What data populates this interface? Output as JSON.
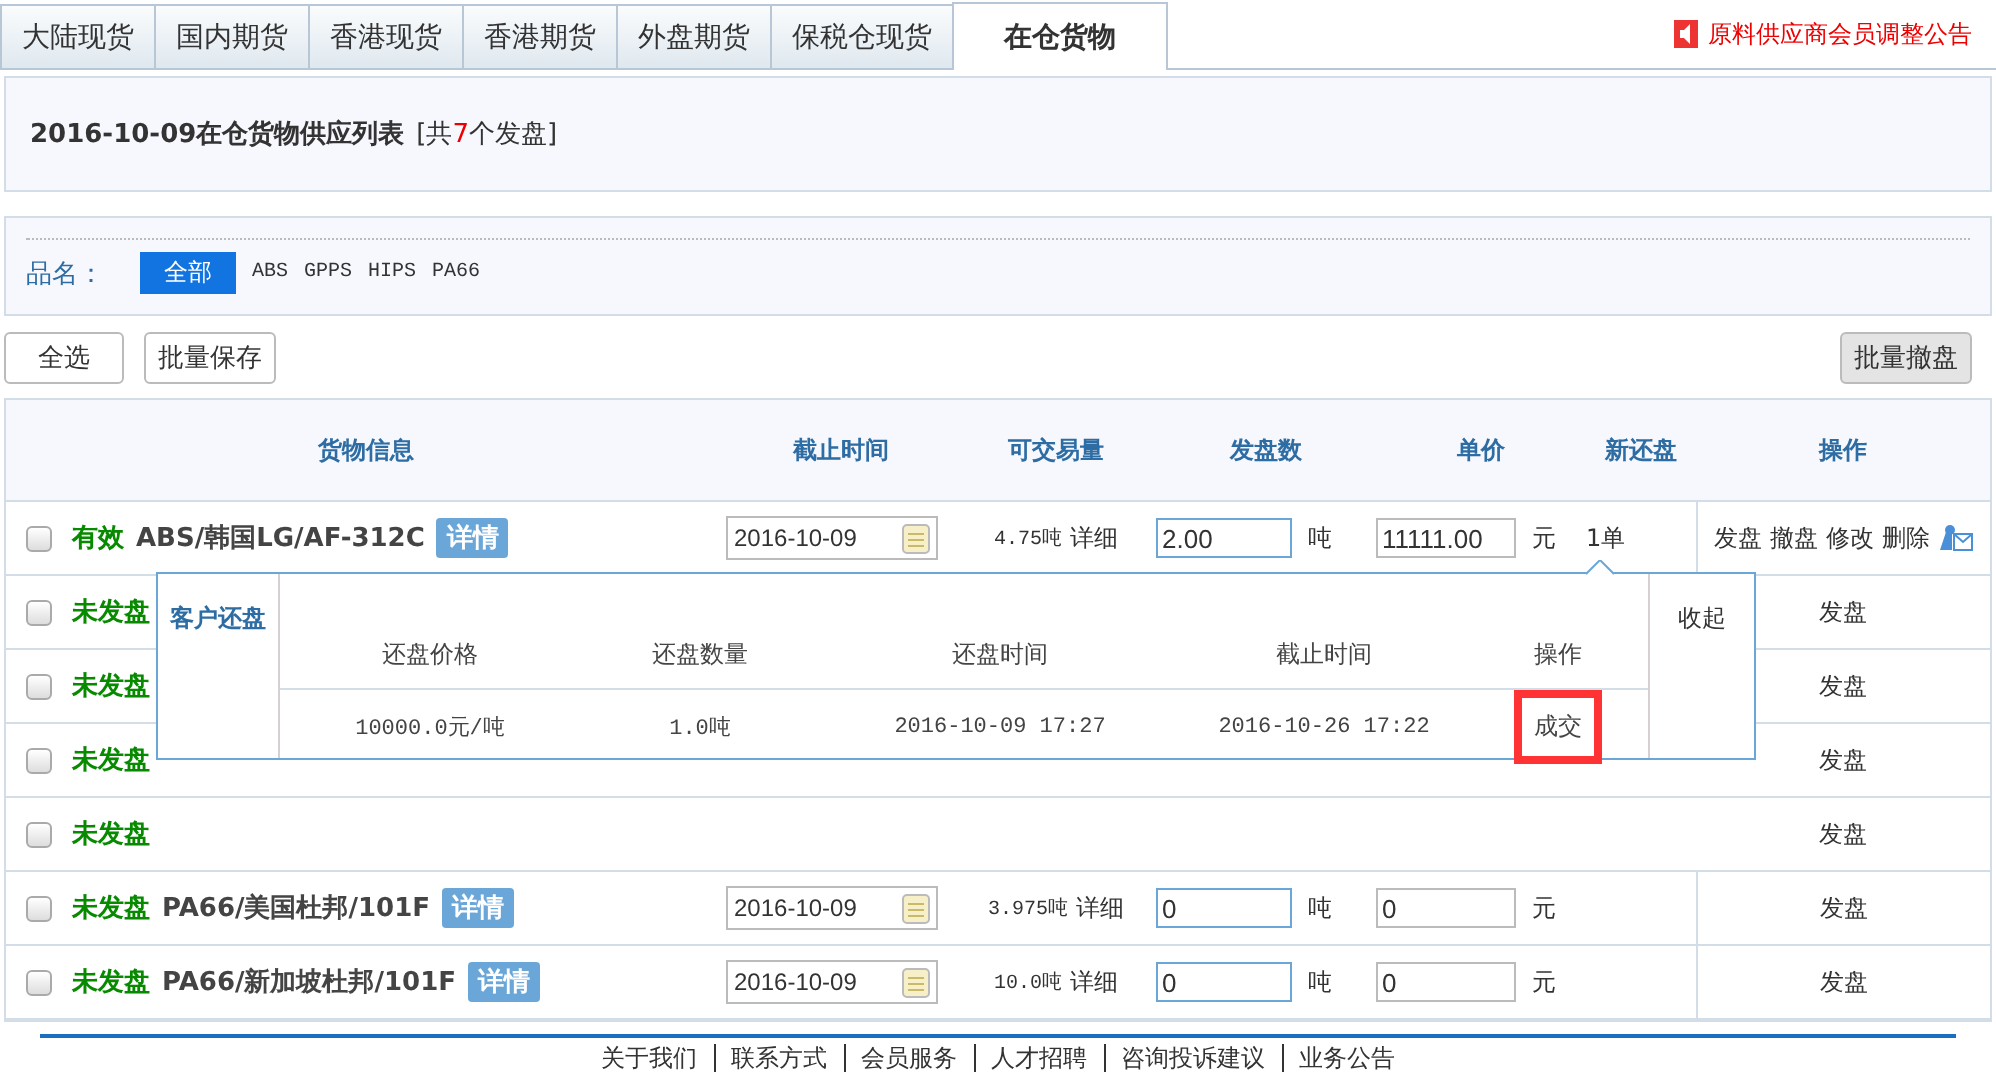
{
  "tabs": [
    {
      "label": "大陆现货",
      "selected": false
    },
    {
      "label": "国内期货",
      "selected": false
    },
    {
      "label": "香港现货",
      "selected": false
    },
    {
      "label": "香港期货",
      "selected": false
    },
    {
      "label": "外盘期货",
      "selected": false
    },
    {
      "label": "保税仓现货",
      "selected": false
    },
    {
      "label": "在仓货物",
      "selected": true
    }
  ],
  "notice": "原料供应商会员调整公告",
  "heading": {
    "title": "2016-10-09在仓货物供应列表",
    "count_prefix": "[共",
    "count": "7",
    "count_suffix": "个发盘]"
  },
  "filter": {
    "label": "品名：",
    "options": [
      {
        "label": "全部",
        "selected": true
      },
      {
        "label": "ABS",
        "selected": false
      },
      {
        "label": "GPPS",
        "selected": false
      },
      {
        "label": "HIPS",
        "selected": false
      },
      {
        "label": "PA66",
        "selected": false
      }
    ]
  },
  "buttons": {
    "select_all": "全选",
    "batch_save": "批量保存",
    "batch_withdraw": "批量撤盘"
  },
  "table": {
    "columns": [
      "货物信息",
      "截止时间",
      "可交易量",
      "发盘数",
      "单价",
      "新还盘",
      "操作"
    ],
    "rows": [
      {
        "checked": false,
        "status": "有效",
        "product": "ABS/韩国LG/AF-312C",
        "detail_tag": "详情",
        "date": "2016-10-09",
        "available": "4.75吨",
        "detail_link": "详细",
        "qty": "2.00",
        "qty_unit": "吨",
        "price": "11111.00",
        "price_unit": "元",
        "new_counter": "1单",
        "actions": [
          "发盘",
          "撤盘",
          "修改",
          "删除"
        ],
        "mail_icon": true
      },
      {
        "checked": false,
        "status": "未发盘",
        "actions": [
          "发盘"
        ]
      },
      {
        "checked": false,
        "status": "未发盘",
        "actions": [
          "发盘"
        ]
      },
      {
        "checked": false,
        "status": "未发盘",
        "actions": [
          "发盘"
        ]
      },
      {
        "checked": false,
        "status": "未发盘",
        "actions": [
          "发盘"
        ]
      },
      {
        "checked": false,
        "status": "未发盘",
        "product": "PA66/美国杜邦/101F",
        "detail_tag": "详情",
        "date": "2016-10-09",
        "available": "3.975吨",
        "detail_link": "详细",
        "qty": "0",
        "qty_unit": "吨",
        "price": "0",
        "price_unit": "元",
        "actions": [
          "发盘"
        ]
      },
      {
        "checked": false,
        "status": "未发盘",
        "product": "PA66/新加坡杜邦/101F",
        "detail_tag": "详情",
        "date": "2016-10-09",
        "available": "10.0吨",
        "detail_link": "详细",
        "qty": "0",
        "qty_unit": "吨",
        "price": "0",
        "price_unit": "元",
        "actions": [
          "发盘"
        ]
      }
    ]
  },
  "counter_popup": {
    "title": "客户还盘",
    "columns": [
      "还盘价格",
      "还盘数量",
      "还盘时间",
      "截止时间",
      "操作"
    ],
    "rows": [
      {
        "price": "10000.0元/吨",
        "qty": "1.0吨",
        "time": "2016-10-09 17:27",
        "deadline": "2016-10-26 17:22",
        "action": "成交",
        "highlighted": true
      }
    ],
    "collapse": "收起"
  },
  "footer": [
    "关于我们",
    "联系方式",
    "会员服务",
    "人才招聘",
    "咨询投诉建议",
    "业务公告"
  ]
}
